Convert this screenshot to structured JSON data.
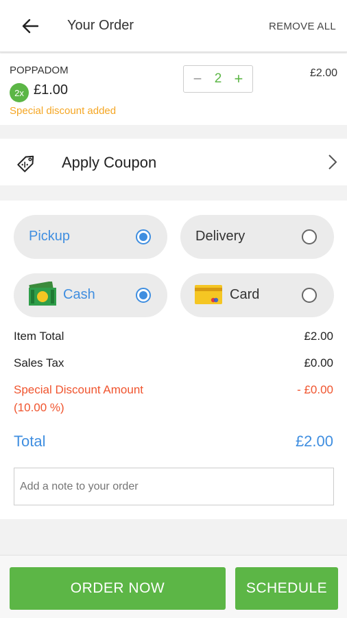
{
  "header": {
    "title": "Your Order",
    "remove_all": "REMOVE ALL"
  },
  "item": {
    "name": "POPPADOM",
    "qty_badge": "2x",
    "unit_price": "£1.00",
    "discount_note": "Special discount added",
    "quantity": "2",
    "minus": "−",
    "plus": "+",
    "line_total": "£2.00"
  },
  "coupon": {
    "label": "Apply Coupon"
  },
  "options": {
    "pickup": "Pickup",
    "delivery": "Delivery",
    "cash": "Cash",
    "card": "Card",
    "selected_fulfilment": "Pickup",
    "selected_payment": "Cash"
  },
  "summary": {
    "item_total_label": "Item Total",
    "item_total": "£2.00",
    "sales_tax_label": "Sales Tax",
    "sales_tax": "£0.00",
    "discount_label": "Special Discount Amount",
    "discount_pct": "(10.00 %)",
    "discount_value": "- £0.00",
    "total_label": "Total",
    "total": "£2.00"
  },
  "note": {
    "placeholder": "Add a note to your order"
  },
  "footer": {
    "order_now": "ORDER NOW",
    "schedule": "SCHEDULE"
  },
  "colors": {
    "green": "#5cb646",
    "blue": "#3f8ee0",
    "orange": "#f5a623",
    "red": "#f0542e"
  }
}
